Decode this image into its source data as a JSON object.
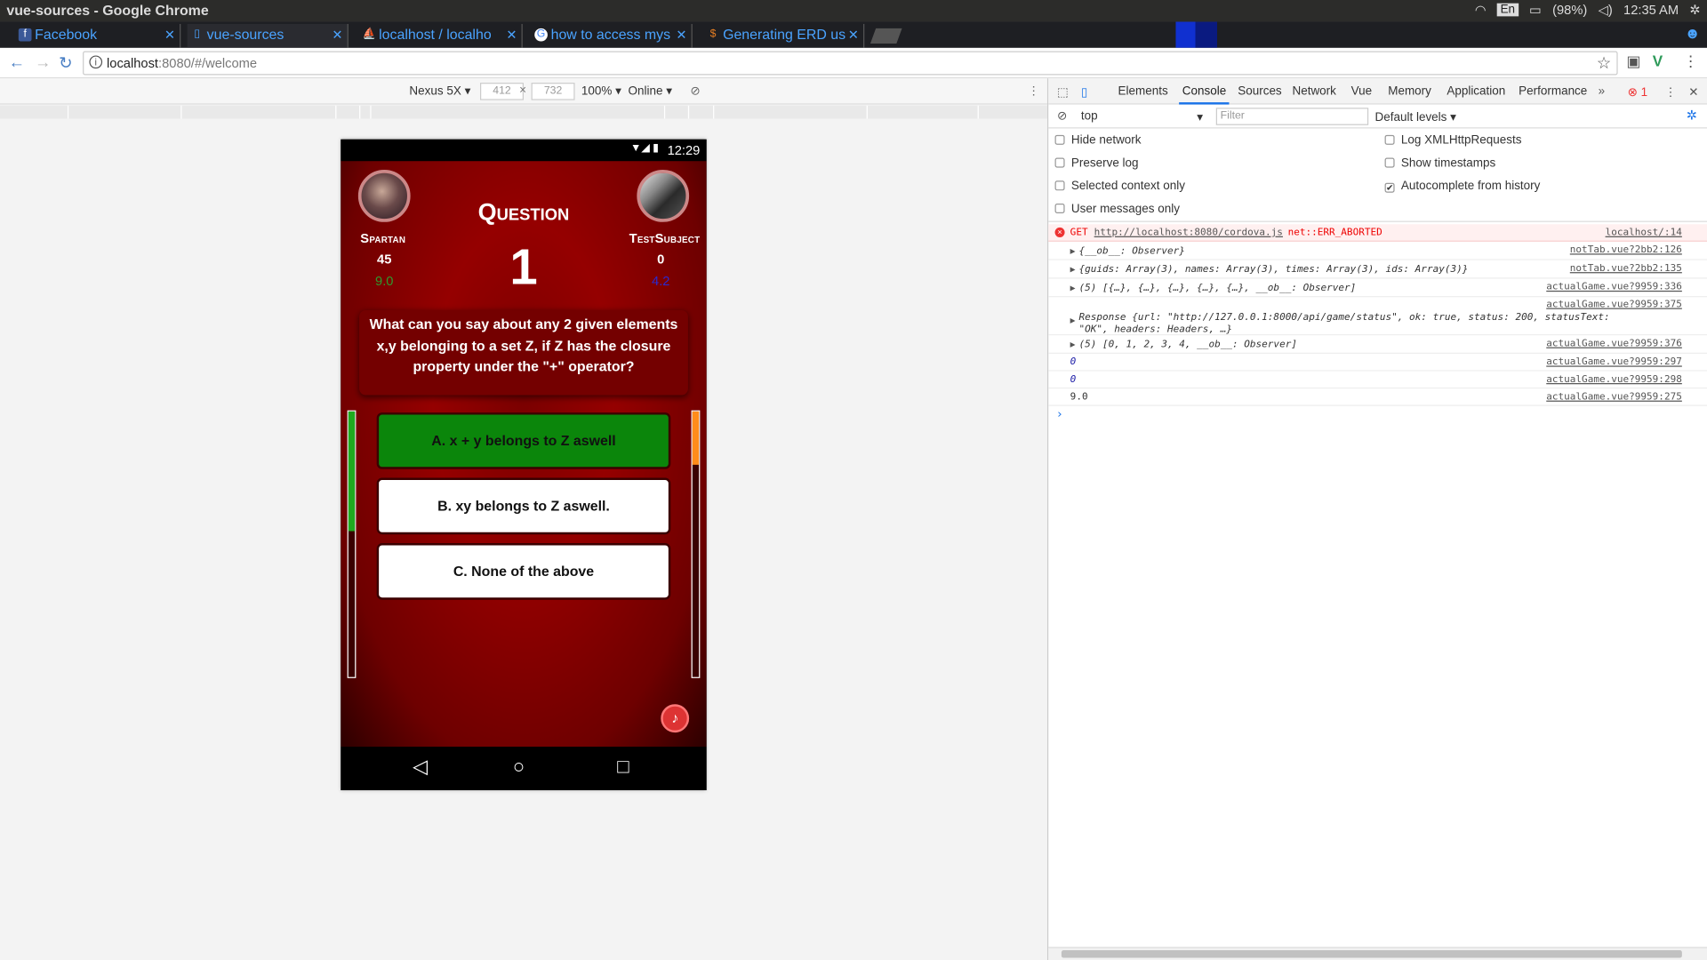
{
  "window_title": "vue-sources - Google Chrome",
  "tray": {
    "lang": "En",
    "battery": "(98%)",
    "time": "12:35 AM"
  },
  "tabs": [
    {
      "label": "Facebook",
      "icon": "f"
    },
    {
      "label": "vue-sources",
      "icon": "d"
    },
    {
      "label": "localhost / localho",
      "icon": "p"
    },
    {
      "label": "how to access mys",
      "icon": "G"
    },
    {
      "label": "Generating ERD us",
      "icon": "$"
    }
  ],
  "address": {
    "host": "localhost",
    "rest": ":8080/#/welcome"
  },
  "emulation": {
    "device": "Nexus 5X",
    "width": "412",
    "times": "×",
    "height": "732",
    "zoom": "100%",
    "network": "Online"
  },
  "phone": {
    "status_time": "12:29",
    "question_label": "Question",
    "question_number": "1",
    "question_text": "What can you say about any 2 given elements x,y belonging to a set Z, if Z has the closure property under the \"+\" operator?",
    "player1": {
      "name": "Spartan",
      "score": "45",
      "time": "9.0",
      "time_color": "#2e9a2e"
    },
    "player2": {
      "name": "TestSubject",
      "score": "0",
      "time": "4.2",
      "time_color": "#2a2ad0"
    },
    "answers": [
      {
        "label": "A. x + y belongs to Z aswell",
        "state": "correct"
      },
      {
        "label": "B. xy belongs to Z aswell.",
        "state": "normal"
      },
      {
        "label": "C. None of the above",
        "state": "normal"
      }
    ],
    "timer_left": {
      "level": 0.45,
      "color": "#1faa1f"
    },
    "timer_right": {
      "level": 0.2,
      "color": "#ff8c1a"
    }
  },
  "devtools": {
    "tabs": [
      "Elements",
      "Console",
      "Sources",
      "Network",
      "Vue",
      "Memory",
      "Application",
      "Performance"
    ],
    "active_tab": "Console",
    "error_count": "1",
    "context": "top",
    "filter_placeholder": "Filter",
    "levels": "Default levels",
    "options_left": [
      "Hide network",
      "Preserve log",
      "Selected context only",
      "User messages only"
    ],
    "options_right": [
      "Log XMLHttpRequests",
      "Show timestamps",
      "Autocomplete from history"
    ],
    "autocomplete_checked": "✔",
    "console": [
      {
        "type": "error",
        "method": "GET",
        "url": "http://localhost:8080/cordova.js",
        "msg": "net::ERR_ABORTED",
        "src": "localhost/:14"
      },
      {
        "type": "obj",
        "text": "{__ob__: Observer}",
        "src": "notTab.vue?2bb2:126"
      },
      {
        "type": "obj",
        "text": "{guids: Array(3), names: Array(3), times: Array(3), ids: Array(3)}",
        "src": "notTab.vue?2bb2:135"
      },
      {
        "type": "obj",
        "text": "(5) [{…}, {…}, {…}, {…}, {…}, __ob__: Observer]",
        "src": "actualGame.vue?9959:336"
      },
      {
        "type": "resp",
        "text": "Response {url: \"http://127.0.0.1:8000/api/game/status\", ok: true, status: 200, statusText: \"OK\", headers: Headers, …}",
        "src": "actualGame.vue?9959:375"
      },
      {
        "type": "obj",
        "text": "(5) [0, 1, 2, 3, 4, __ob__: Observer]",
        "src": "actualGame.vue?9959:376"
      },
      {
        "type": "num",
        "text": "0",
        "src": "actualGame.vue?9959:297"
      },
      {
        "type": "num",
        "text": "0",
        "src": "actualGame.vue?9959:298"
      },
      {
        "type": "plain",
        "text": "9.0",
        "src": "actualGame.vue?9959:275"
      }
    ]
  }
}
